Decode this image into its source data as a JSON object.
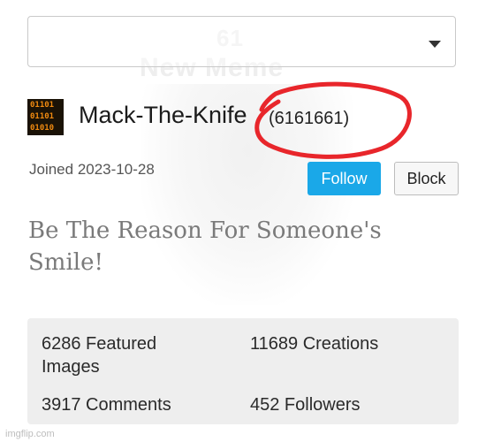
{
  "background": {
    "meme_number": "61",
    "meme_caption": "New Meme"
  },
  "dropdown": {
    "selected": ""
  },
  "profile": {
    "avatar_rows": [
      "01101",
      "01101",
      "01010"
    ],
    "username": "Mack-The-Knife",
    "points": "(6161661)",
    "joined": "Joined 2023-10-28",
    "bio": "Be The Reason For Someone's Smile!"
  },
  "actions": {
    "follow": "Follow",
    "block": "Block"
  },
  "stats": {
    "featured": "6286 Featured Images",
    "creations": "11689 Creations",
    "comments": "3917 Comments",
    "followers": "452 Followers"
  },
  "annotation": {
    "circle_color": "#e8262b"
  },
  "colors": {
    "follow_button": "#1aa8e8",
    "stats_panel": "#eeeeee"
  },
  "watermark": "imgflip.com"
}
